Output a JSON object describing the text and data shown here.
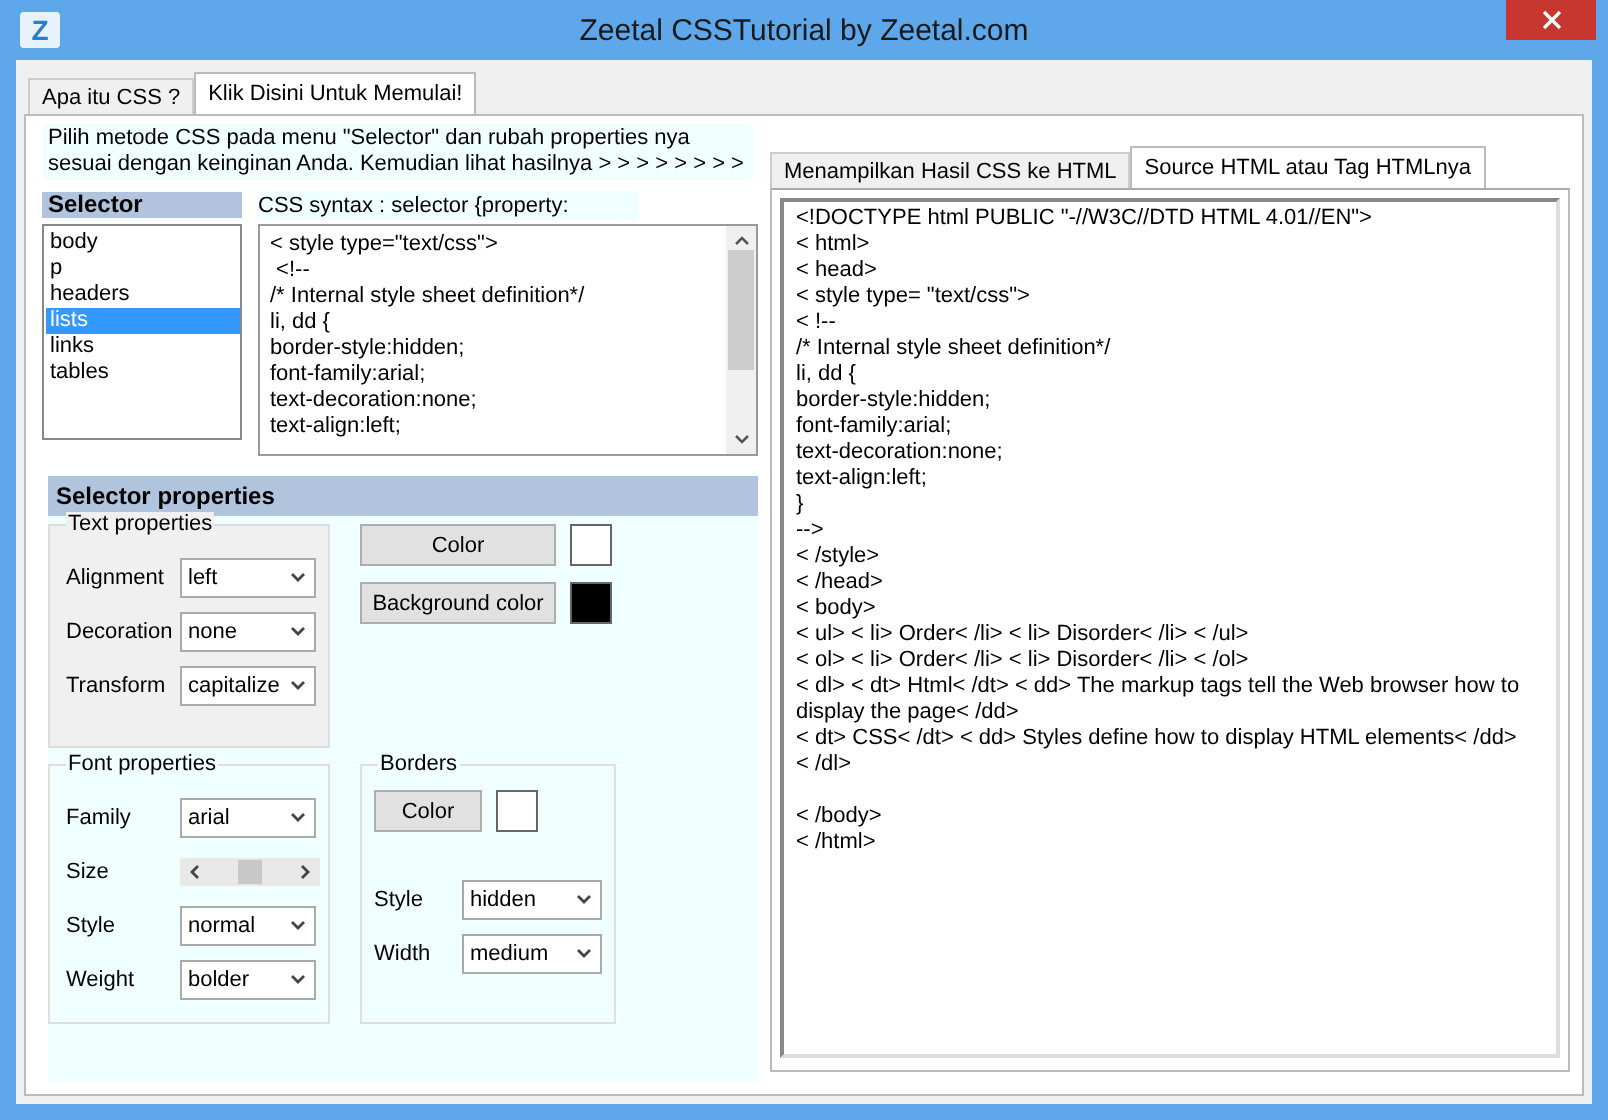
{
  "window": {
    "title": "Zeetal CSSTutorial by Zeetal.com",
    "app_icon": "Z"
  },
  "tabs": [
    {
      "label": "Apa itu CSS ?",
      "selected": false
    },
    {
      "label": "Klik Disini Untuk Memulai!",
      "selected": true
    }
  ],
  "instructions": "Pilih metode CSS pada menu \"Selector\" dan rubah properties nya sesuai dengan keinginan Anda. Kemudian lihat hasilnya > > > > > > > >",
  "selector": {
    "heading": "Selector",
    "items": [
      {
        "label": "body",
        "selected": false
      },
      {
        "label": "p",
        "selected": false
      },
      {
        "label": "headers",
        "selected": false
      },
      {
        "label": "lists",
        "selected": true
      },
      {
        "label": "links",
        "selected": false
      },
      {
        "label": "tables",
        "selected": false
      }
    ]
  },
  "css_syntax": {
    "label": "CSS syntax :  selector {property:",
    "lines": [
      "< style type=\"text/css\">",
      " <!--",
      "/* Internal style sheet definition*/",
      "li, dd {",
      "border-style:hidden;",
      "font-family:arial;",
      "text-decoration:none;",
      "text-align:left;"
    ]
  },
  "selector_properties": {
    "title": "Selector properties",
    "text_properties": {
      "title": "Text properties",
      "fields": [
        {
          "label": "Alignment",
          "value": "left"
        },
        {
          "label": "Decoration",
          "value": "none"
        },
        {
          "label": "Transform",
          "value": "capitalize"
        }
      ]
    },
    "color_buttons": [
      {
        "label": "Color",
        "color": "#ffffff"
      },
      {
        "label": "Background color",
        "color": "#000000"
      }
    ],
    "font_properties": {
      "title": "Font properties",
      "fields": [
        {
          "kind": "dropdown",
          "label": "Family",
          "value": "arial"
        },
        {
          "kind": "slider",
          "label": "Size",
          "level": 0.5
        },
        {
          "kind": "dropdown",
          "label": "Style",
          "value": "normal"
        },
        {
          "kind": "dropdown",
          "label": "Weight",
          "value": "bolder"
        }
      ]
    },
    "borders": {
      "title": "Borders",
      "color_button": {
        "label": "Color",
        "color": "#ffffff"
      },
      "fields": [
        {
          "label": "Style",
          "value": "hidden"
        },
        {
          "label": "Width",
          "value": "medium"
        }
      ]
    }
  },
  "result_tabs": [
    {
      "label": "Menampilkan Hasil CSS ke HTML",
      "selected": false
    },
    {
      "label": "Source HTML atau Tag HTMLnya",
      "selected": true
    }
  ],
  "source_lines": [
    "<!DOCTYPE html PUBLIC \"-//W3C//DTD HTML 4.01//EN\">",
    "< html>",
    "< head>",
    "< style type= \"text/css\">",
    " < !--",
    "/* Internal style sheet definition*/",
    "li, dd {",
    "border-style:hidden;",
    "font-family:arial;",
    "text-decoration:none;",
    "text-align:left;",
    "}",
    "-->",
    " < /style>",
    "< /head>",
    "< body>",
    "< ul>  < li> Order< /li>  < li> Disorder< /li>  < /ul>",
    "< ol>  < li> Order< /li>  < li> Disorder< /li>  < /ol>",
    "< dl>  < dt> Html< /dt>  < dd> The markup tags tell the Web browser how to display the page< /dd>",
    " < dt> CSS< /dt>  < dd> Styles define how to display HTML elements< /dd>",
    "< /dl>"
  ],
  "source_end_lines": [
    "< /body>",
    "< /html>"
  ]
}
